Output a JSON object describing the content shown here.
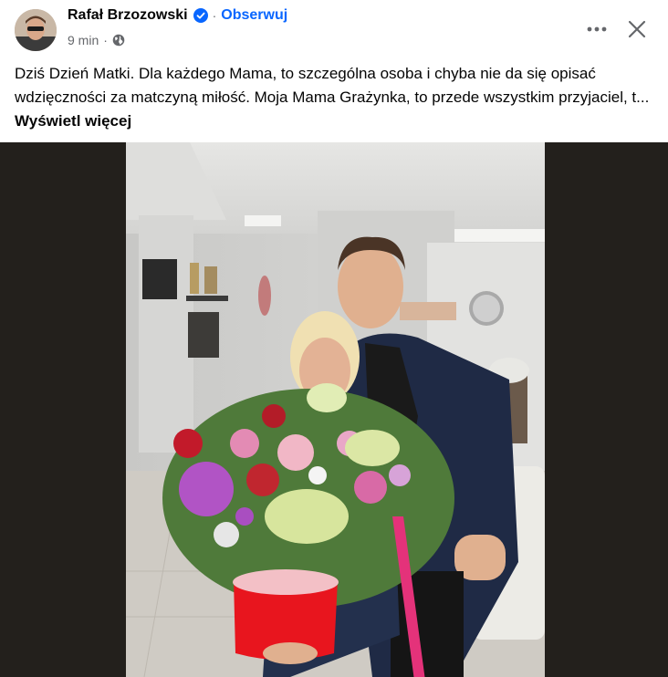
{
  "post": {
    "author": "Rafał Brzozowski",
    "follow_label": "Obserwuj",
    "time": "9 min",
    "text": "Dziś Dzień Matki. Dla każdego Mama, to szczególna osoba i chyba nie da się opisać wdzięczności za matczyną miłość. Moja Mama Grażynka, to przede wszystkim przyjaciel, t...",
    "see_more_label": "Wyświetl więcej"
  },
  "icons": {
    "verified": "verified-badge-icon",
    "privacy": "globe-icon",
    "more": "more-options-icon",
    "close": "close-icon"
  },
  "colors": {
    "accent": "#0866ff",
    "muted": "#65676b",
    "text": "#050505",
    "media_background": "#23201c"
  }
}
